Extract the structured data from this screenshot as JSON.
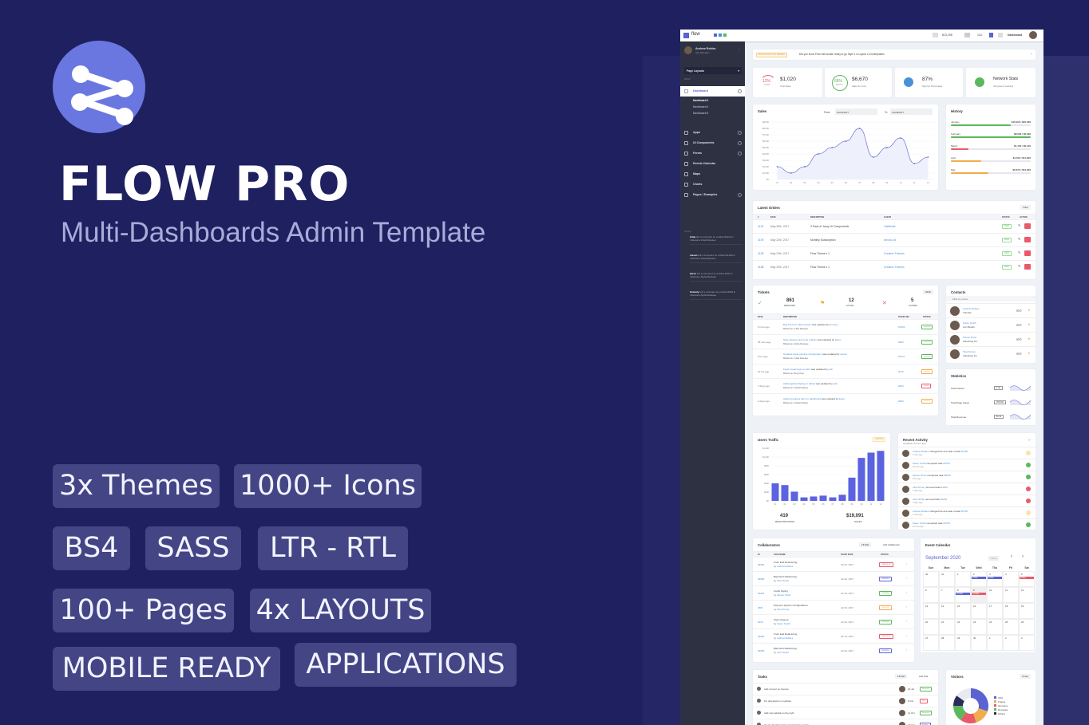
{
  "promo": {
    "title": "FLOW PRO",
    "subtitle": "Multi-Dashboards Admin Template",
    "badges": [
      "3x Themes",
      "1000+ Icons",
      "BS4",
      "SASS",
      "LTR - RTL",
      "100+ Pages",
      "4x LAYOUTS",
      "MOBILE READY",
      "APPLICATIONS"
    ],
    "colors": {
      "background": "#1f2060",
      "logo": "#6a77e0",
      "badge": "#434585"
    }
  },
  "dashboard": {
    "topbar": {
      "brand": "flow",
      "balance": "$13,298",
      "messages": "124",
      "user_menu": "Dashboard"
    },
    "sidebar": {
      "user_name": "Andrew Robles",
      "user_role": "Site Manager",
      "layout_select": "Page Layouts",
      "section_label": "MENU",
      "items": [
        {
          "label": "Dashboard",
          "active": true
        },
        {
          "label": "Apps"
        },
        {
          "label": "UI Components"
        },
        {
          "label": "Forms"
        },
        {
          "label": "Events Calendar"
        },
        {
          "label": "Maps"
        },
        {
          "label": "Charts"
        },
        {
          "label": "Pages / Examples"
        }
      ],
      "sub_items": [
        "Dashboard 1",
        "Dashboard 2",
        "Dashboard 3"
      ],
      "activity_label": "Activity",
      "activity": [
        {
          "user": "brian",
          "text": "left a comment on a ticket #1224 in milestone Initial Release"
        },
        {
          "user": "steven",
          "text": "left a comment on a ticket #1220 in milestone Initial Release"
        },
        {
          "user": "karen",
          "text": "left a comment on a ticket #202 in milestone Alpha Release"
        },
        {
          "user": "thomely",
          "text": "left a comment on a ticket #203 in milestone Alpha Release"
        }
      ]
    },
    "alert": {
      "tag": "BOOTSTRAP 4 BY DESIGN",
      "text": "Did you know Flow will include ready to go Style 1 & Layout 2-4 boilerplates"
    },
    "stats": [
      {
        "percent": "12%",
        "percent_label": "TODAY",
        "value": "$1,020",
        "label": "Total Sales"
      },
      {
        "percent": "68%",
        "percent_label": "MONTH",
        "value": "$6,670",
        "label": "Sales for June"
      },
      {
        "value": "87%",
        "label": "Sign-Up Percentage"
      },
      {
        "value": "Network Stats",
        "label": "All systems working!"
      }
    ],
    "sales": {
      "title": "Sales",
      "from_label": "From",
      "from": "10/24/2017",
      "to_label": "To",
      "to": "10/28/2017"
    },
    "history": {
      "title": "History",
      "rows": [
        {
          "month": "January",
          "value": "$15,000 / $20,000",
          "progress": 0.75,
          "color": "#5cb85c"
        },
        {
          "month": "February",
          "value": "$8,590 / $5,290",
          "progress": 1.0,
          "color": "#5cb85c"
        },
        {
          "month": "March",
          "value": "$1,150 / $5,120",
          "progress": 0.22,
          "color": "#e85a6a"
        },
        {
          "month": "April",
          "value": "$4,420 / $11,600",
          "progress": 0.38,
          "color": "#f0ad4e"
        },
        {
          "month": "May",
          "value": "$5,675 / $12,000",
          "progress": 0.47,
          "color": "#f0ad4e"
        }
      ]
    },
    "orders": {
      "title": "Latest Orders",
      "filter": "Filter",
      "columns": [
        "#",
        "DATE",
        "DESCRIPTION",
        "CLIENT",
        "STATUS",
        "ACTION"
      ],
      "rows": [
        {
          "id": "4191",
          "date": "May 30th, 2017",
          "desc": "3 Pack of Jozzy UI Components",
          "client": "Cartflorite",
          "status": "PAID"
        },
        {
          "id": "4190",
          "date": "May 22th, 2017",
          "desc": "Monthly Subscription",
          "client": "Sevos Ltd",
          "status": "PAID"
        },
        {
          "id": "4189",
          "date": "May 22th, 2017",
          "desc": "Flow Theme x 1",
          "client": "Creative Themes",
          "status": "PAID"
        },
        {
          "id": "4188",
          "date": "May 20th, 2017",
          "desc": "Flow Theme x 1",
          "client": "Creative Themes",
          "status": "PAID"
        }
      ]
    },
    "tickets": {
      "title": "Tickets",
      "new": "NEW",
      "summary": [
        {
          "value": "861",
          "label": "RESOLVED"
        },
        {
          "value": "12",
          "label": "ACTIVE"
        },
        {
          "value": "5",
          "label": "CLOSED"
        }
      ],
      "columns": [
        "DATE",
        "DESCRIPTION",
        "TICKET NO.",
        "STATUS"
      ],
      "rows": [
        {
          "date": "5 mins ago",
          "link": "Bug fixes for initial release",
          "by": "thomely",
          "milestone": "Milestone: Initial Release",
          "no": "#7223",
          "status": "resolved",
          "color": "#5cb85c"
        },
        {
          "date": "45 mins ago",
          "link": "Style cleanup and code refactor",
          "by": "karen",
          "milestone": "Milestone: Alpha Release",
          "no": "#202",
          "status": "resolved",
          "color": "#5cb85c"
        },
        {
          "date": "9 hrs ago",
          "link": "Updated asset pipeline configuration",
          "by": "steven",
          "milestone": "Milestone: Initial Release",
          "no": "#7221",
          "status": "resolved",
          "color": "#5cb85c"
        },
        {
          "date": "13 hrs ago",
          "link": "Fixed visual bugs on tabs",
          "by": "john",
          "milestone": "Milestone: Bug Fixes",
          "no": "#176",
          "status": "pending",
          "color": "#f0ad4e"
        },
        {
          "date": "7 days ago",
          "link": "Added global styling on tables",
          "by": "john",
          "milestone": "Milestone: Global Styling",
          "no": "#204",
          "status": "closed",
          "color": "#e85a6a"
        },
        {
          "date": "2 days ago",
          "link": "Added progress bars on dashboard",
          "by": "karen",
          "milestone": "Milestone: Global Styling",
          "no": "#203",
          "status": "pending",
          "color": "#f0ad4e"
        }
      ]
    },
    "contacts": {
      "title": "Contacts",
      "search_placeholder": "Filter by name",
      "rows": [
        {
          "name": "Andrew Robles",
          "company": "Themify"
        },
        {
          "name": "Karen Smith",
          "company": "LLC Books"
        },
        {
          "name": "Steven Short",
          "company": "Industries Inc."
        },
        {
          "name": "Tara Kinney",
          "company": "Industries Inc."
        }
      ]
    },
    "statistics": {
      "title": "Statistics",
      "rows": [
        {
          "label": "Total Visitors",
          "value": "1.4k"
        },
        {
          "label": "Total Page Views",
          "value": "258,000"
        },
        {
          "label": "Total Revenue",
          "value": "$1.1k"
        }
      ]
    },
    "traffic": {
      "title": "Users Traffic",
      "badge": "MONTH",
      "registrations": "419",
      "registrations_label": "REGISTRATIONS",
      "sales": "$19,091",
      "sales_label": "SALES"
    },
    "activity": {
      "title": "Recent Activity",
      "subtitle": "Updated 10 mins ago",
      "rows": [
        {
          "user": "Andrew Robles",
          "action": "changed the due date of task",
          "task": "#2750",
          "time": "2 mins ago",
          "state": "#f5e6a8"
        },
        {
          "user": "Karen Smith",
          "action": "completed task",
          "task": "#2750",
          "time": "20 mins ago",
          "state": "#5cb85c"
        },
        {
          "user": "Steven Short",
          "action": "completed task",
          "task": "#6025",
          "time": "9 hrs ago",
          "state": "#5cb85c"
        },
        {
          "user": "Tara Kinney",
          "action": "removed task",
          "task": "#1232",
          "time": "2 days ago",
          "state": "#e85a6a"
        },
        {
          "user": "John Smith",
          "action": "removed task",
          "task": "#1232",
          "time": "3 days ago",
          "state": "#e85a6a"
        },
        {
          "user": "Andrew Robles",
          "action": "changed the due date of task",
          "task": "#2750",
          "time": "2 mins ago",
          "state": "#f5e6a8"
        },
        {
          "user": "Karen Smith",
          "action": "completed task",
          "task": "#2750",
          "time": "20 mins ago",
          "state": "#5cb85c"
        }
      ]
    },
    "collaborators": {
      "title": "Collaborators",
      "filter": "FILTER",
      "add": "Add Collaborator",
      "columns": [
        "ID",
        "TASK NAME",
        "START DATE",
        "STATUS"
      ],
      "rows": [
        {
          "id": "#2084",
          "task": "Front End Refactoring",
          "by": "Andrew Robles",
          "date": "Jul 24, 2017",
          "status": "CANCELED",
          "color": "#e85a6a"
        },
        {
          "id": "#2082",
          "task": "Back End Refactoring",
          "by": "John Smith",
          "date": "Jul 20, 2017",
          "status": "PENDING",
          "color": "#5b63d3"
        },
        {
          "id": "#1024",
          "task": "Cards Styling",
          "by": "Steven Short",
          "date": "Jul 19, 2017",
          "status": "FINISHED",
          "color": "#5cb85c"
        },
        {
          "id": "4681",
          "task": "Payment System Configurations",
          "by": "Tara Kinney",
          "date": "Jul 03, 2017",
          "status": "ON HOLD",
          "color": "#f0ad4e"
        },
        {
          "id": "#230",
          "task": "Style Cleanup",
          "by": "Karen Smith",
          "date": "Jul 02, 2017",
          "status": "FINISHED",
          "color": "#5cb85c"
        },
        {
          "id": "#2084",
          "task": "Front End Refactoring",
          "by": "Andrew Robles",
          "date": "Jul 14, 2017",
          "status": "CANCELED",
          "color": "#e85a6a"
        },
        {
          "id": "#2082",
          "task": "Back End Refactoring",
          "by": "John Smith",
          "date": "Jul 20, 2017",
          "status": "PENDING",
          "color": "#5b63d3"
        }
      ]
    },
    "calendar": {
      "title": "Event Calendar",
      "month": "September 2020",
      "today": "today",
      "days": [
        "Sun",
        "Mon",
        "Tue",
        "Wed",
        "Thu",
        "Fri",
        "Sat"
      ],
      "dates": [
        "30",
        "31",
        "1",
        "2",
        "3",
        "4",
        "5",
        "6",
        "7",
        "8",
        "9",
        "10",
        "11",
        "12",
        "13",
        "14",
        "15",
        "16",
        "17",
        "18",
        "19",
        "20",
        "21",
        "22",
        "23",
        "24",
        "25",
        "26",
        "27",
        "28",
        "29",
        "30",
        "1",
        "2",
        "3"
      ],
      "events": [
        {
          "date_index": 3,
          "label": "8:00a",
          "color": "#5b63d3"
        },
        {
          "date_index": 4,
          "label": "8:00a",
          "color": "#5b63d3"
        },
        {
          "date_index": 6,
          "label": "8:00a",
          "color": "#e85a6a"
        },
        {
          "date_index": 9,
          "label": "10:00a",
          "color": "#5b63d3"
        },
        {
          "date_index": 10,
          "label": "10:00a",
          "color": "#e85a6a"
        }
      ]
    },
    "tasks": {
      "title": "Tasks",
      "filter": "FILTER",
      "add": "Add Task",
      "rows": [
        {
          "text": "Add convert on bounce",
          "date": "20 Jul",
          "tag": "Research",
          "color": "#5cb85c"
        },
        {
          "text": "Fix dropdowns in navbars",
          "date": "8 Oct",
          "tag": "Bug",
          "color": "#e85a6a"
        },
        {
          "text": "Add new sidebar to the right",
          "date": "11 Oct",
          "tag": "Research",
          "color": "#5cb85c"
        },
        {
          "text": "Create Dashboard for administrative tasks",
          "date": "20 Oct",
          "tag": "Feature",
          "color": "#5b63d3"
        }
      ]
    },
    "visitors": {
      "title": "Visitors",
      "range": "Today",
      "slices": [
        {
          "name": "USA",
          "value": 30,
          "color": "#5b63d3"
        },
        {
          "name": "France",
          "value": 15,
          "color": "#f0ad4e"
        },
        {
          "name": "Germany",
          "value": 15,
          "color": "#e85a6a"
        },
        {
          "name": "Romania",
          "value": 15,
          "color": "#5cb85c"
        },
        {
          "name": "Others",
          "value": 10,
          "color": "#2a2d5a"
        },
        {
          "name": "",
          "value": 15,
          "color": "#e8eaef"
        }
      ]
    }
  },
  "chart_data": [
    {
      "type": "line",
      "title": "Sales",
      "categories": [
        "01",
        "02",
        "03",
        "04",
        "05",
        "06",
        "07",
        "08",
        "09",
        "10",
        "11",
        "12"
      ],
      "values": [
        2000,
        1000,
        2000,
        4000,
        5000,
        6000,
        8000,
        3500,
        5000,
        6500,
        2500,
        3500
      ],
      "yticks": [
        "$0",
        "$1,000",
        "$2,000",
        "$3,000",
        "$4,000",
        "$5,000",
        "$6,000",
        "$7,000",
        "$8,000",
        "$9,000"
      ],
      "ylim": [
        0,
        9000
      ],
      "color": "#6a6fd6"
    },
    {
      "type": "bar",
      "title": "Users Traffic",
      "categories": [
        "01",
        "02",
        "03",
        "04",
        "05",
        "06",
        "07",
        "08",
        "09",
        "10",
        "11",
        "12"
      ],
      "values": [
        400,
        360,
        210,
        80,
        100,
        120,
        80,
        140,
        530,
        980,
        1100,
        1140
      ],
      "yticks": [
        "$0",
        "$200",
        "$400",
        "$600",
        "$800",
        "$1,000",
        "$1,200"
      ],
      "ylim": [
        0,
        1200
      ],
      "color": "#5b63e0"
    }
  ]
}
